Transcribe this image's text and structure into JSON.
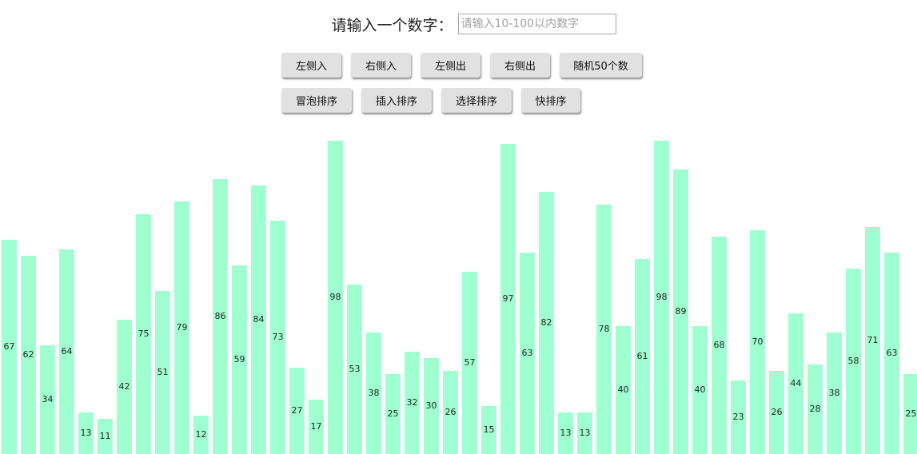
{
  "prompt": {
    "label": "请输入一个数字：",
    "placeholder": "请输入10-100以内数字",
    "value": ""
  },
  "buttons_row1": [
    "左侧入",
    "右侧入",
    "左侧出",
    "右侧出",
    "随机50个数"
  ],
  "buttons_row2": [
    "冒泡排序",
    "插入排序",
    "选择排序",
    "快排序"
  ],
  "chart_data": {
    "type": "bar",
    "values": [
      67,
      62,
      34,
      64,
      13,
      11,
      42,
      75,
      51,
      79,
      12,
      86,
      59,
      84,
      73,
      27,
      17,
      98,
      53,
      38,
      25,
      32,
      30,
      26,
      57,
      15,
      97,
      63,
      82,
      13,
      13,
      78,
      40,
      61,
      98,
      89,
      40,
      68,
      23,
      70,
      26,
      44,
      28,
      38,
      58,
      71,
      63,
      25
    ],
    "color": "#a0ffd0"
  }
}
